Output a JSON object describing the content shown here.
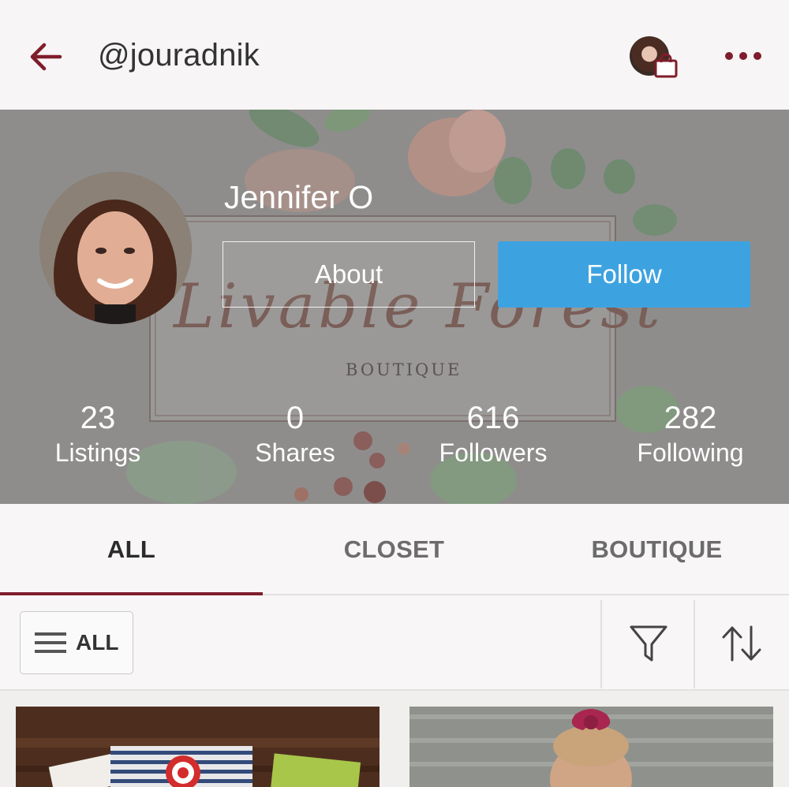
{
  "header": {
    "handle": "@jouradnik"
  },
  "profile": {
    "name": "Jennifer O",
    "about_label": "About",
    "follow_label": "Follow",
    "banner_text": "Livable Forest",
    "banner_subtext": "BOUTIQUE"
  },
  "stats": [
    {
      "value": "23",
      "label": "Listings"
    },
    {
      "value": "0",
      "label": "Shares"
    },
    {
      "value": "616",
      "label": "Followers"
    },
    {
      "value": "282",
      "label": "Following"
    }
  ],
  "tabs": [
    {
      "label": "ALL",
      "active": true
    },
    {
      "label": "CLOSET",
      "active": false
    },
    {
      "label": "BOUTIQUE",
      "active": false
    }
  ],
  "filterbar": {
    "menu_label": "ALL"
  },
  "colors": {
    "accent": "#7f1d2b",
    "follow_button": "#3da3e0",
    "banner_overlay": "#8f8e8d"
  },
  "icons": {
    "back": "arrow-left-icon",
    "more": "more-dots-icon",
    "bag": "shopping-bag-icon",
    "menu": "hamburger-icon",
    "filter": "funnel-icon",
    "sort": "sort-arrows-icon"
  }
}
